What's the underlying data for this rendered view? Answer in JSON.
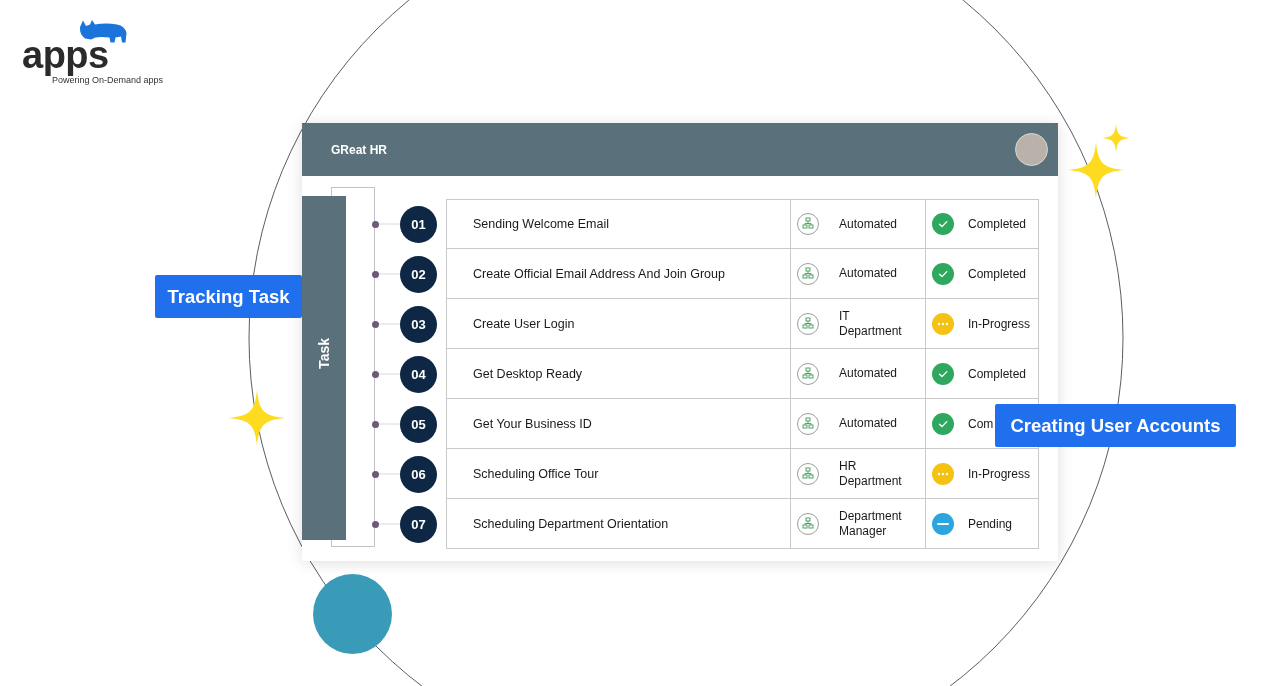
{
  "logo": {
    "wordmark": "apps",
    "tagline": "Powering On-Demand apps"
  },
  "card": {
    "title": "GReat HR",
    "side_label": "Task"
  },
  "tasks": [
    {
      "number": "01",
      "name": "Sending Welcome Email",
      "assignee": "Automated",
      "status": {
        "kind": "completed",
        "label": "Completed"
      }
    },
    {
      "number": "02",
      "name": "Create Official Email Address And Join Group",
      "assignee": "Automated",
      "status": {
        "kind": "completed",
        "label": "Completed"
      }
    },
    {
      "number": "03",
      "name": "Create User Login",
      "assignee": "IT Department",
      "status": {
        "kind": "in_progress",
        "label": "In-Progress"
      }
    },
    {
      "number": "04",
      "name": "Get Desktop Ready",
      "assignee": "Automated",
      "status": {
        "kind": "completed",
        "label": "Completed"
      }
    },
    {
      "number": "05",
      "name": "Get Your Business ID",
      "assignee": "Automated",
      "status": {
        "kind": "completed",
        "label": "Com"
      }
    },
    {
      "number": "06",
      "name": "Scheduling Office Tour",
      "assignee": "HR Department",
      "status": {
        "kind": "in_progress",
        "label": "In-Progress"
      }
    },
    {
      "number": "07",
      "name": "Scheduling Department Orientation",
      "assignee": "Department Manager",
      "status": {
        "kind": "pending",
        "label": "Pending"
      }
    }
  ],
  "callouts": [
    "Tracking Task",
    "Creating User Accounts"
  ]
}
